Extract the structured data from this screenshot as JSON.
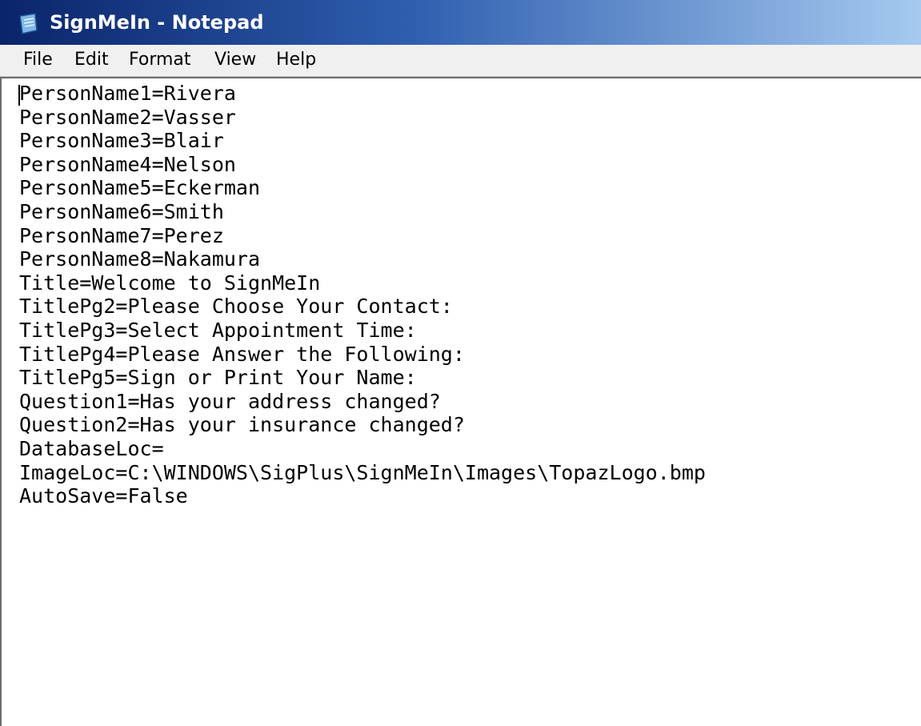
{
  "window": {
    "title": "SignMeIn - Notepad",
    "icon": "notepad-icon"
  },
  "menu": {
    "file": "File",
    "edit": "Edit",
    "format": "Format",
    "view": "View",
    "help": "Help"
  },
  "document": {
    "lines": [
      "PersonName1=Rivera",
      "PersonName2=Vasser",
      "PersonName3=Blair",
      "PersonName4=Nelson",
      "PersonName5=Eckerman",
      "PersonName6=Smith",
      "PersonName7=Perez",
      "PersonName8=Nakamura",
      "Title=Welcome to SignMeIn",
      "TitlePg2=Please Choose Your Contact:",
      "TitlePg3=Select Appointment Time:",
      "TitlePg4=Please Answer the Following:",
      "TitlePg5=Sign or Print Your Name:",
      "Question1=Has your address changed?",
      "Question2=Has your insurance changed?",
      "DatabaseLoc=",
      "ImageLoc=C:\\WINDOWS\\SigPlus\\SignMeIn\\Images\\TopazLogo.bmp",
      "AutoSave=False"
    ]
  },
  "colors": {
    "titlebar_start": "#0a246a",
    "titlebar_end": "#a6caf0",
    "menubar": "#f0f0f0",
    "editor_bg": "#ffffff"
  }
}
